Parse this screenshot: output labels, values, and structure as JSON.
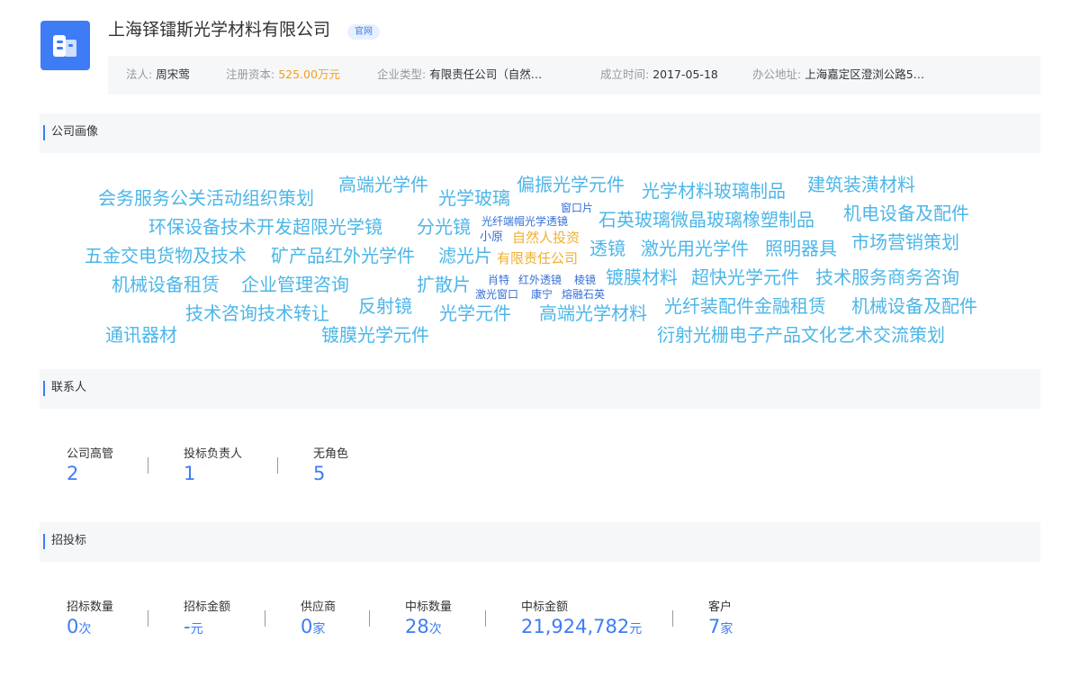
{
  "company": {
    "name": "上海铎镭斯光学材料有限公司",
    "official_badge": "官网",
    "legal_rep_label": "法人:",
    "legal_rep": "周宋莺",
    "capital_label": "注册资本:",
    "capital": "525.00万元",
    "type_label": "企业类型:",
    "type": "有限责任公司（自然…",
    "founded_label": "成立时间:",
    "founded": "2017-05-18",
    "address_label": "办公地址:",
    "address": "上海嘉定区澄浏公路5…"
  },
  "sections": {
    "portrait": "公司画像",
    "contacts": "联系人",
    "bidding": "招投标"
  },
  "word_cloud": [
    {
      "text": "会务服务公关活动组织策划",
      "style": "light"
    },
    {
      "text": "高端光学件",
      "style": "light"
    },
    {
      "text": "光学玻璃",
      "style": "light"
    },
    {
      "text": "偏振光学元件",
      "style": "light"
    },
    {
      "text": "光学材料玻璃制品",
      "style": "light"
    },
    {
      "text": "建筑装潢材料",
      "style": "light"
    },
    {
      "text": "窗口片",
      "style": "dark"
    },
    {
      "text": "环保设备技术开发超限光学镜",
      "style": "light"
    },
    {
      "text": "分光镜",
      "style": "light"
    },
    {
      "text": "光纤端帽光学透镜",
      "style": "dark"
    },
    {
      "text": "石英玻璃微晶玻璃橡塑制品",
      "style": "light"
    },
    {
      "text": "机电设备及配件",
      "style": "light"
    },
    {
      "text": "小原",
      "style": "dark"
    },
    {
      "text": "自然人投资",
      "style": "yellow"
    },
    {
      "text": "五金交电货物及技术",
      "style": "light"
    },
    {
      "text": "矿产品红外光学件",
      "style": "light"
    },
    {
      "text": "滤光片",
      "style": "light"
    },
    {
      "text": "有限责任公司",
      "style": "yellow"
    },
    {
      "text": "透镜",
      "style": "light"
    },
    {
      "text": "激光用光学件",
      "style": "light"
    },
    {
      "text": "照明器具",
      "style": "light"
    },
    {
      "text": "市场营销策划",
      "style": "light"
    },
    {
      "text": "机械设备租赁",
      "style": "light"
    },
    {
      "text": "企业管理咨询",
      "style": "light"
    },
    {
      "text": "扩散片",
      "style": "light"
    },
    {
      "text": "肖特",
      "style": "dark"
    },
    {
      "text": "红外透镜",
      "style": "dark"
    },
    {
      "text": "棱镜",
      "style": "dark"
    },
    {
      "text": "镀膜材料",
      "style": "light"
    },
    {
      "text": "超快光学元件",
      "style": "light"
    },
    {
      "text": "技术服务商务咨询",
      "style": "light"
    },
    {
      "text": "激光窗口",
      "style": "dark"
    },
    {
      "text": "康宁",
      "style": "dark"
    },
    {
      "text": "熔融石英",
      "style": "dark"
    },
    {
      "text": "技术咨询技术转让",
      "style": "light"
    },
    {
      "text": "反射镜",
      "style": "light"
    },
    {
      "text": "光学元件",
      "style": "light"
    },
    {
      "text": "高端光学材料",
      "style": "light"
    },
    {
      "text": "光纤装配件金融租赁",
      "style": "light"
    },
    {
      "text": "机械设备及配件",
      "style": "light"
    },
    {
      "text": "通讯器材",
      "style": "light"
    },
    {
      "text": "镀膜光学元件",
      "style": "light"
    },
    {
      "text": "衍射光栅电子产品文化艺术交流策划",
      "style": "light"
    }
  ],
  "contacts": [
    {
      "label": "公司高管",
      "value": "2"
    },
    {
      "label": "投标负责人",
      "value": "1"
    },
    {
      "label": "无角色",
      "value": "5"
    }
  ],
  "bidding": [
    {
      "label": "招标数量",
      "value": "0",
      "unit": "次"
    },
    {
      "label": "招标金额",
      "value": "-",
      "unit": "元"
    },
    {
      "label": "供应商",
      "value": "0",
      "unit": "家"
    },
    {
      "label": "中标数量",
      "value": "28",
      "unit": "次"
    },
    {
      "label": "中标金额",
      "value": "21,924,782",
      "unit": "元"
    },
    {
      "label": "客户",
      "value": "7",
      "unit": "家"
    }
  ],
  "colors": {
    "accent": "#3d7cf5",
    "money": "#f0a020",
    "cloud_light": "#4cb6e8",
    "cloud_dark": "#3470d6",
    "cloud_yellow": "#f0b030"
  }
}
